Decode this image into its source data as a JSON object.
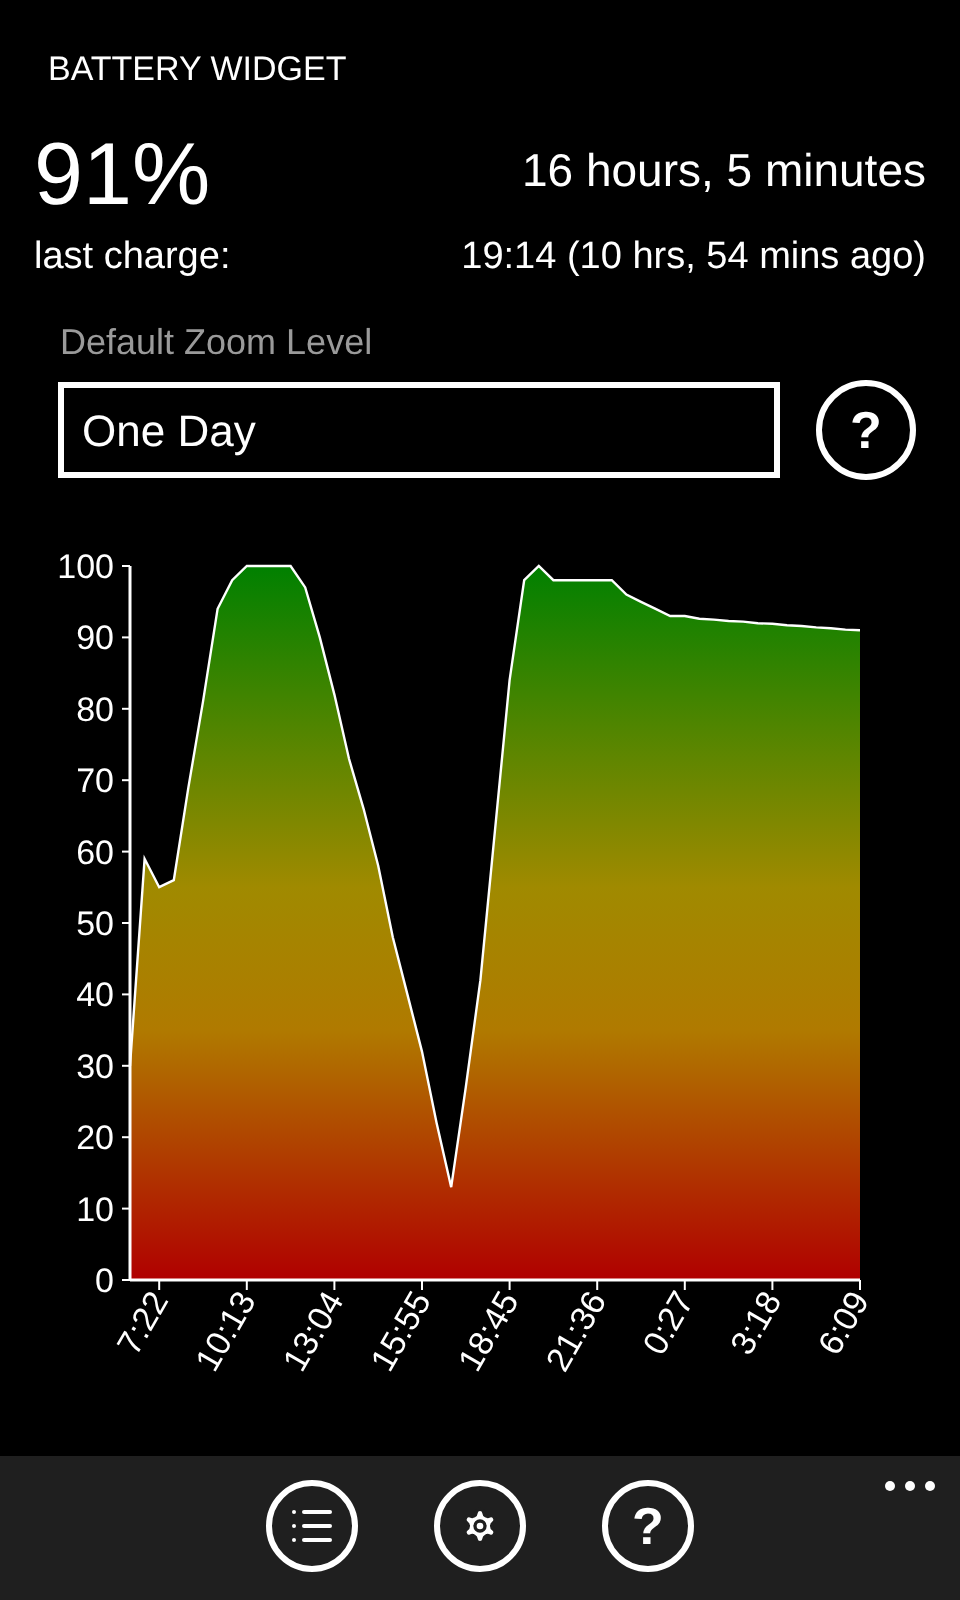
{
  "app_title": "BATTERY WIDGET",
  "level_text": "91%",
  "remaining": "16 hours, 5 minutes",
  "last_charge_label": "last charge:",
  "last_charge_value": "19:14 (10 hrs, 54 mins ago)",
  "zoom": {
    "label": "Default Zoom Level",
    "value": "One Day",
    "help": "?"
  },
  "chart_data": {
    "type": "area",
    "ylim": [
      0,
      100
    ],
    "yticks": [
      0,
      10,
      20,
      30,
      40,
      50,
      60,
      70,
      80,
      90,
      100
    ],
    "categories": [
      null,
      null,
      "7:22",
      null,
      null,
      null,
      null,
      null,
      "10:13",
      null,
      null,
      null,
      null,
      null,
      "13:04",
      null,
      null,
      null,
      null,
      null,
      "15:55",
      null,
      null,
      null,
      null,
      null,
      "18:45",
      null,
      null,
      null,
      null,
      null,
      "21:36",
      null,
      null,
      null,
      null,
      null,
      "0:27",
      null,
      null,
      null,
      null,
      null,
      "3:18",
      null,
      null,
      null,
      null,
      null,
      "6:09"
    ],
    "series": [
      {
        "color": "#ffffff",
        "values": [
          30,
          59,
          55,
          56,
          69,
          81,
          94,
          98,
          100,
          100,
          100,
          100,
          97,
          90,
          82,
          73,
          66,
          58,
          48,
          40,
          32,
          22,
          13,
          27,
          42,
          63,
          84,
          98,
          100,
          98,
          98,
          98,
          98,
          98,
          96,
          95,
          94,
          93,
          93,
          92.6,
          92.5,
          92.3,
          92.2,
          92,
          91.9,
          91.7,
          91.6,
          91.4,
          91.3,
          91.1,
          91
        ]
      }
    ]
  },
  "app_bar": {
    "buttons": [
      {
        "kind": "list"
      },
      {
        "kind": "settings"
      },
      {
        "kind": "help",
        "text": "?"
      }
    ]
  }
}
